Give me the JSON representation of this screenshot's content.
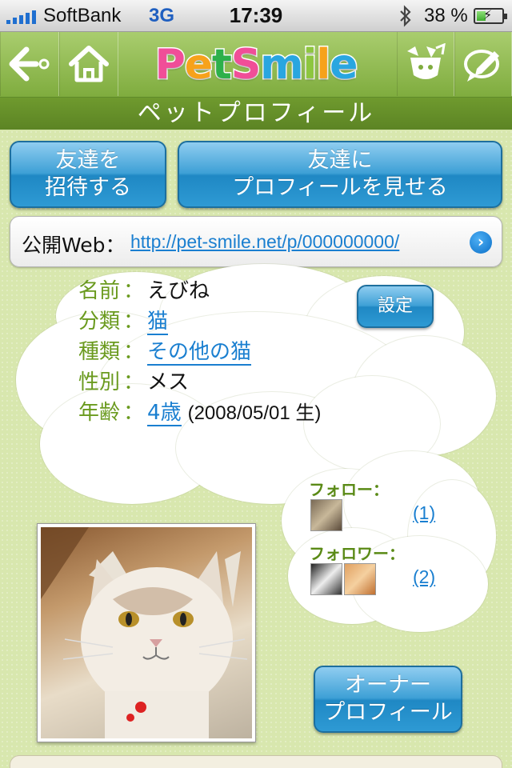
{
  "status_bar": {
    "carrier": "SoftBank",
    "network": "3G",
    "time": "17:39",
    "battery": "38 %",
    "battery_level": 0.38
  },
  "nav": {
    "logo_text": [
      "P",
      "e",
      "t",
      "S",
      "m",
      "i",
      "l",
      "e"
    ],
    "logo_colors": [
      "#f04e98",
      "#f7a21b",
      "#2db04b",
      "#f04e98",
      "#29a6e0",
      "#8dc63f",
      "#f7a21b",
      "#29a6e0"
    ]
  },
  "title": "ペットプロフィール",
  "actions": {
    "invite_line1": "友達を",
    "invite_line2": "招待する",
    "show_line1": "友達に",
    "show_line2": "プロフィールを見せる"
  },
  "public_web": {
    "label": "公開Web：",
    "url": "http://pet-smile.net/p/000000000/"
  },
  "profile": {
    "settings_label": "設定",
    "rows": [
      {
        "key": "名前",
        "sep": "：",
        "value": "えびね"
      },
      {
        "key": "分類",
        "sep": "：",
        "value": "猫"
      },
      {
        "key": "種類",
        "sep": "：",
        "value": "その他の猫"
      },
      {
        "key": "性別",
        "sep": "：",
        "value": "メス"
      },
      {
        "key": "年齢",
        "sep": "：",
        "value": "4歳",
        "extra": "(2008/05/01 生)"
      }
    ]
  },
  "social": {
    "follow_label": "フォロー：",
    "follow_count": "(1)",
    "follower_label": "フォロワー：",
    "follower_count": "(2)"
  },
  "owner_button": {
    "line1": "オーナー",
    "line2": "プロフィール"
  }
}
